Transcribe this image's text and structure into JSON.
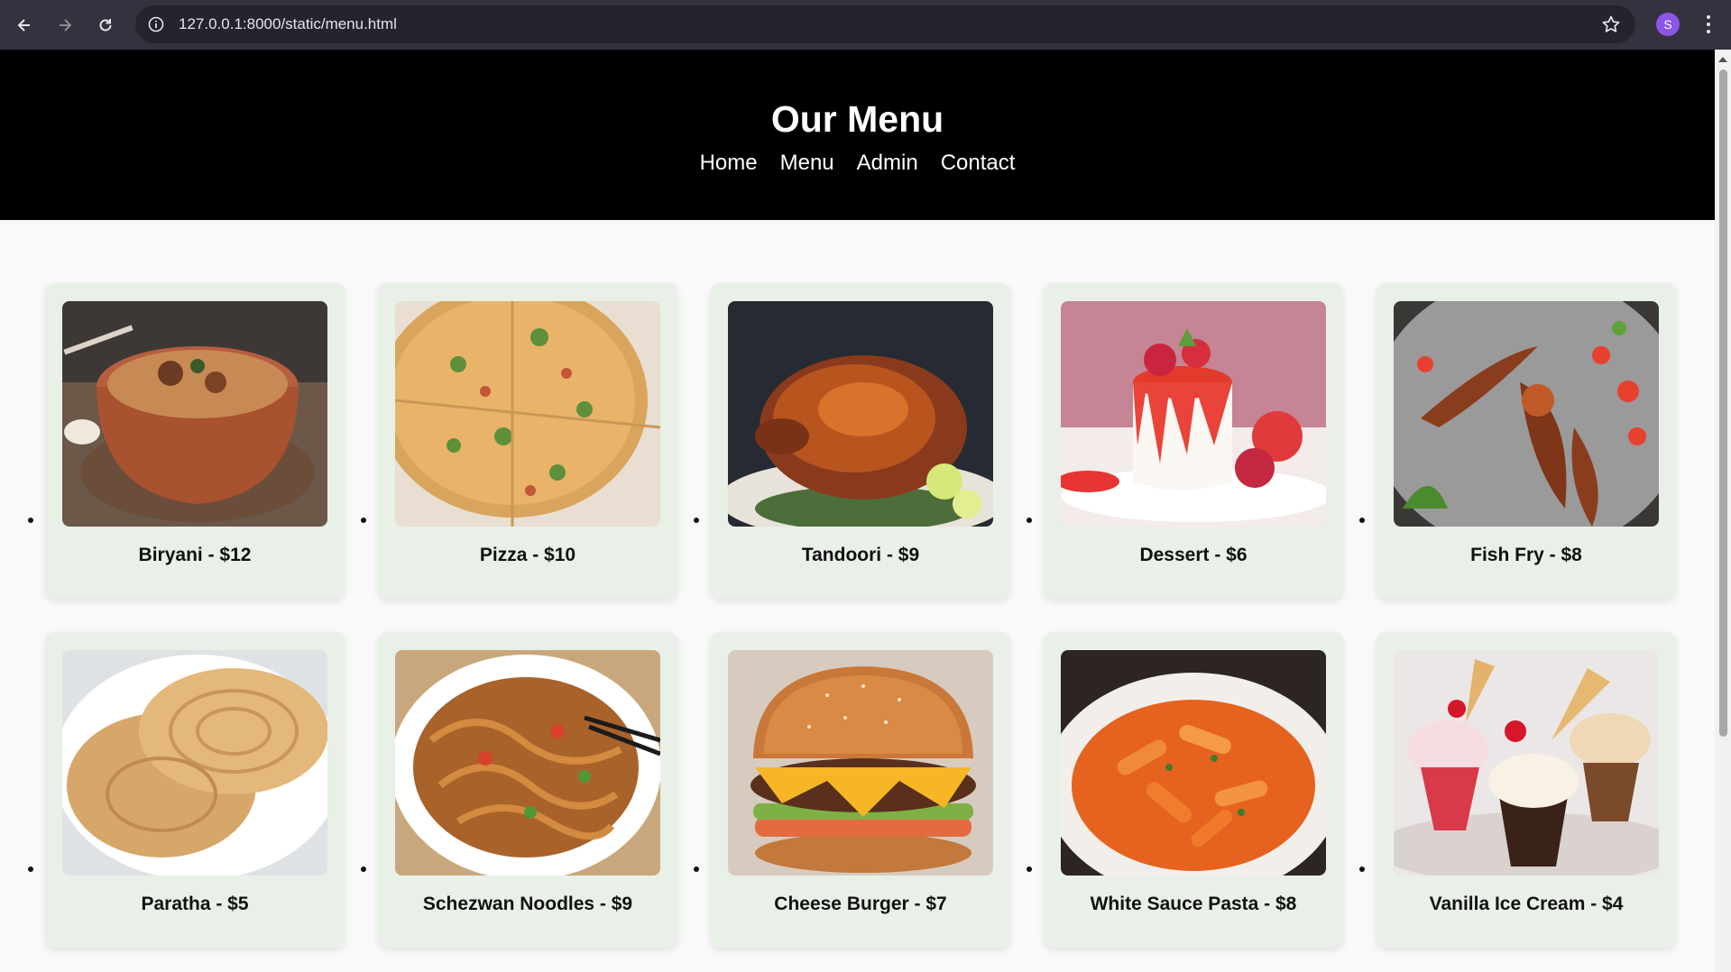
{
  "browser": {
    "url": "127.0.0.1:8000/static/menu.html",
    "profile_initial": "S",
    "icons": [
      "back-arrow-icon",
      "forward-arrow-icon",
      "reload-icon",
      "site-info-icon",
      "bookmark-star-icon",
      "kebab-menu-icon"
    ]
  },
  "header": {
    "title": "Our Menu",
    "nav": [
      {
        "label": "Home"
      },
      {
        "label": "Menu"
      },
      {
        "label": "Admin"
      },
      {
        "label": "Contact"
      }
    ]
  },
  "menu": {
    "items": [
      {
        "label": "Biryani - $12",
        "image": "biryani-photo"
      },
      {
        "label": "Pizza - $10",
        "image": "pizza-photo"
      },
      {
        "label": "Tandoori - $9",
        "image": "tandoori-photo"
      },
      {
        "label": "Dessert - $6",
        "image": "dessert-photo"
      },
      {
        "label": "Fish Fry - $8",
        "image": "fish-fry-photo"
      },
      {
        "label": "Paratha - $5",
        "image": "paratha-photo"
      },
      {
        "label": "Schezwan Noodles - $9",
        "image": "noodles-photo"
      },
      {
        "label": "Cheese Burger - $7",
        "image": "burger-photo"
      },
      {
        "label": "White Sauce Pasta - $8",
        "image": "pasta-photo"
      },
      {
        "label": "Vanilla Ice Cream - $4",
        "image": "ice-cream-photo"
      }
    ]
  },
  "colors": {
    "chrome": "#35323f",
    "header_bg": "#000000",
    "card_bg": "#e9f0e8",
    "page_bg": "#f8f9f8"
  }
}
